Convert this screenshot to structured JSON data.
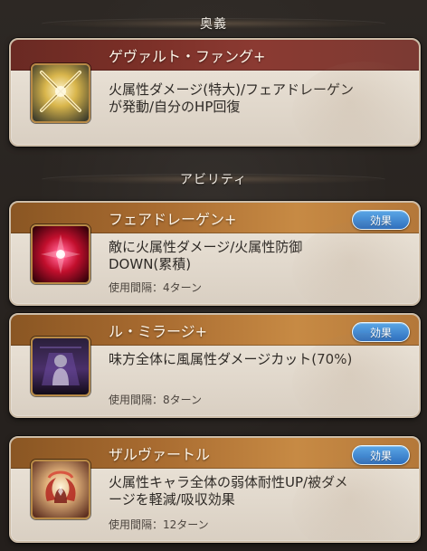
{
  "sections": {
    "ougi": {
      "title": "奥義"
    },
    "abilities": {
      "title": "アビリティ"
    }
  },
  "ougi": {
    "name": "ゲヴァルト・ファング+",
    "description": "火属性ダメージ(特大)/フェアドレーゲン\nが発動/自分のHP回復",
    "icon": "crossed-swords-icon"
  },
  "abilities": [
    {
      "name": "フェアドレーゲン+",
      "description": "敵に火属性ダメージ/火属性防御\nDOWN(累積)",
      "cooldown": "使用間隔：4ターン",
      "effect_label": "効果",
      "icon": "fire-burst-icon"
    },
    {
      "name": "ル・ミラージ+",
      "description": "味方全体に風属性ダメージカット(70%)",
      "cooldown": "使用間隔：8ターン",
      "effect_label": "効果",
      "icon": "dark-figure-icon"
    },
    {
      "name": "ザルヴァートル",
      "description": "火属性キャラ全体の弱体耐性UP/被ダメ\nージを軽減/吸収効果",
      "cooldown": "使用間隔：12ターン",
      "effect_label": "効果",
      "icon": "dragon-crest-icon"
    }
  ],
  "colors": {
    "background": "#2a2521",
    "ougi_title_bar": "#7a2f27",
    "ability_title_bar": "#b4783a",
    "effect_button": "#2e6fbe"
  }
}
